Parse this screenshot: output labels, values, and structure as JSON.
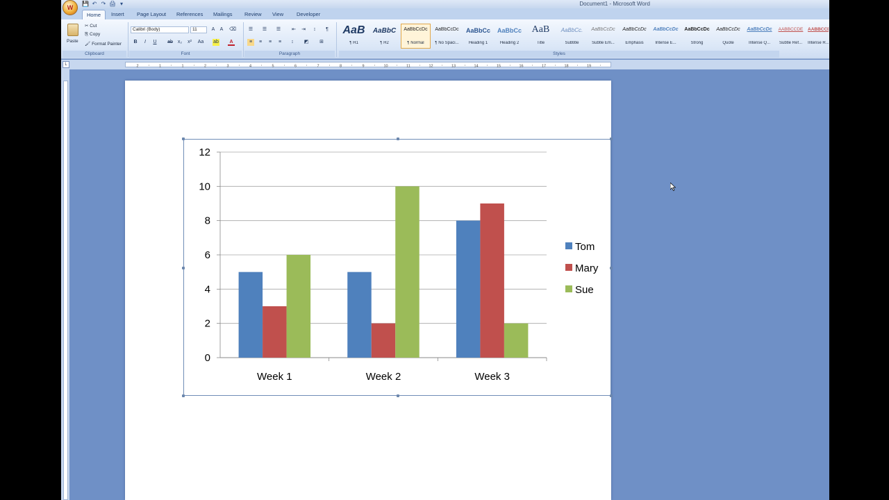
{
  "window": {
    "title": "Document1 - Microsoft Word",
    "office_button": "W"
  },
  "quick_access": [
    "💾",
    "↶",
    "↷",
    "🖨",
    "▾"
  ],
  "tabs": [
    {
      "label": "Home",
      "active": true
    },
    {
      "label": "Insert"
    },
    {
      "label": "Page Layout"
    },
    {
      "label": "References"
    },
    {
      "label": "Mailings"
    },
    {
      "label": "Review"
    },
    {
      "label": "View"
    },
    {
      "label": "Developer"
    }
  ],
  "clipboard": {
    "paste": "Paste",
    "cut": "Cut",
    "copy": "Copy",
    "format_painter": "Format Painter",
    "group_label": "Clipboard"
  },
  "font": {
    "name": "Calibri (Body)",
    "size": "11",
    "group_label": "Font"
  },
  "paragraph": {
    "group_label": "Paragraph"
  },
  "styles": {
    "group_label": "Styles",
    "items": [
      {
        "sample": "AaB",
        "name": "¶ H1"
      },
      {
        "sample": "AaBbC",
        "name": "¶ H2"
      },
      {
        "sample": "AaBbCcDc",
        "name": "¶ Normal",
        "selected": true
      },
      {
        "sample": "AaBbCcDc",
        "name": "¶ No Spaci..."
      },
      {
        "sample": "AaBbCc",
        "name": "Heading 1"
      },
      {
        "sample": "AaBbCc",
        "name": "Heading 2"
      },
      {
        "sample": "AaB",
        "name": "Title"
      },
      {
        "sample": "AaBbCc.",
        "name": "Subtitle"
      },
      {
        "sample": "AaBbCcDc",
        "name": "Subtle Em..."
      },
      {
        "sample": "AaBbCcDc",
        "name": "Emphasis"
      },
      {
        "sample": "AaBbCcDc",
        "name": "Intense E..."
      },
      {
        "sample": "AaBbCcDc",
        "name": "Strong"
      },
      {
        "sample": "AaBbCcDc",
        "name": "Quote"
      },
      {
        "sample": "AaBbCcDc",
        "name": "Intense Q..."
      },
      {
        "sample": "AABBCCDE",
        "name": "Subtle Ref..."
      },
      {
        "sample": "AABBCCDI",
        "name": "Intense R..."
      }
    ]
  },
  "ruler": {
    "numbers": [
      "2",
      "1",
      "1",
      "2",
      "3",
      "4",
      "5",
      "6",
      "7",
      "8",
      "9",
      "10",
      "11",
      "12",
      "13",
      "14",
      "15",
      "16",
      "17",
      "18",
      "19"
    ]
  },
  "chart_data": {
    "type": "bar",
    "categories": [
      "Week 1",
      "Week 2",
      "Week 3"
    ],
    "series": [
      {
        "name": "Tom",
        "values": [
          5,
          5,
          8
        ],
        "color": "#4f81bd"
      },
      {
        "name": "Mary",
        "values": [
          3,
          2,
          9
        ],
        "color": "#c0504d"
      },
      {
        "name": "Sue",
        "values": [
          6,
          10,
          2
        ],
        "color": "#9bbb59"
      }
    ],
    "ylim": [
      0,
      12
    ],
    "yticks": [
      0,
      2,
      4,
      6,
      8,
      10,
      12
    ],
    "grid": true,
    "legend": "right"
  }
}
